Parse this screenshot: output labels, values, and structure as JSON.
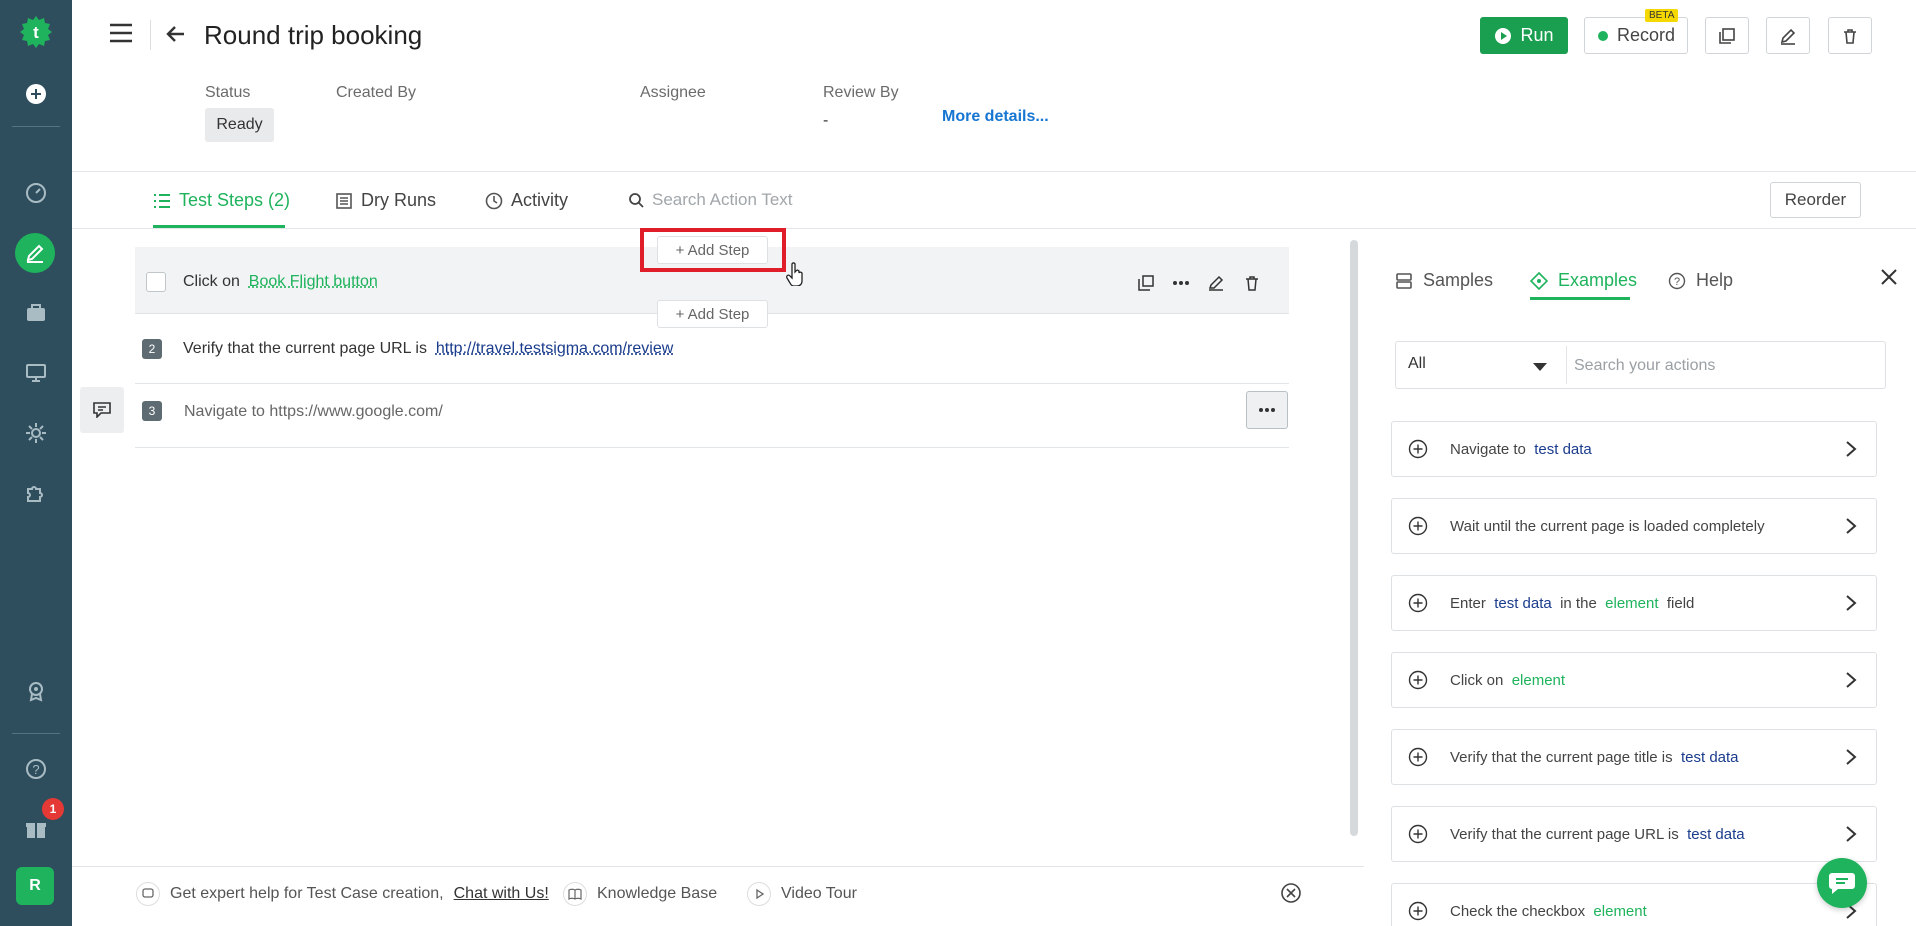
{
  "app": {
    "title": "Round trip booking",
    "accent_color": "#1eb35c",
    "rail_color": "#2e4e5e"
  },
  "toolbar": {
    "run_label": "Run",
    "record_label": "Record",
    "beta_label": "BETA"
  },
  "meta": {
    "status_label": "Status",
    "status_value": "Ready",
    "created_by_label": "Created By",
    "assignee_label": "Assignee",
    "review_by_label": "Review By",
    "review_by_value": "-",
    "more_details": "More details..."
  },
  "tabs": [
    {
      "label": "Test Steps (2)",
      "active": true
    },
    {
      "label": "Dry Runs",
      "active": false
    },
    {
      "label": "Activity",
      "active": false
    }
  ],
  "search_action_placeholder": "Search Action Text",
  "reorder_label": "Reorder",
  "add_step_label": "+ Add Step",
  "steps": [
    {
      "prefix": "Click on",
      "link": "Book Flight button"
    },
    {
      "number": "2",
      "prefix": "Verify that the current page URL is",
      "link": "http://travel.testsigma.com/review"
    },
    {
      "number": "3",
      "text": "Navigate to https://www.google.com/"
    }
  ],
  "bottom_bar": {
    "help_text": "Get expert help for Test Case creation,",
    "chat_link": "Chat with Us!",
    "knowledge_base": "Knowledge Base",
    "video_tour": "Video Tour"
  },
  "right_panel": {
    "tabs": [
      {
        "label": "Samples",
        "active": false
      },
      {
        "label": "Examples",
        "active": true
      },
      {
        "label": "Help",
        "active": false
      }
    ],
    "filter_value": "All",
    "search_placeholder": "Search your actions",
    "actions": [
      {
        "parts": [
          {
            "t": "Navigate to",
            "k": "plain"
          },
          {
            "t": "test data",
            "k": "tv"
          }
        ]
      },
      {
        "parts": [
          {
            "t": "Wait until the current page is loaded completely",
            "k": "plain"
          }
        ]
      },
      {
        "parts": [
          {
            "t": "Enter",
            "k": "plain"
          },
          {
            "t": "test data",
            "k": "tv"
          },
          {
            "t": "in the",
            "k": "plain"
          },
          {
            "t": "element",
            "k": "el"
          },
          {
            "t": "field",
            "k": "plain"
          }
        ]
      },
      {
        "parts": [
          {
            "t": "Click on",
            "k": "plain"
          },
          {
            "t": "element",
            "k": "el"
          }
        ]
      },
      {
        "parts": [
          {
            "t": "Verify that the current page title is",
            "k": "plain"
          },
          {
            "t": "test data",
            "k": "tv"
          }
        ]
      },
      {
        "parts": [
          {
            "t": "Verify that the current page URL is",
            "k": "plain"
          },
          {
            "t": "test data",
            "k": "tv"
          }
        ]
      },
      {
        "parts": [
          {
            "t": "Check the checkbox",
            "k": "plain"
          },
          {
            "t": "element",
            "k": "el"
          }
        ]
      }
    ]
  },
  "notifications_count": "1",
  "avatar_initial": "R"
}
